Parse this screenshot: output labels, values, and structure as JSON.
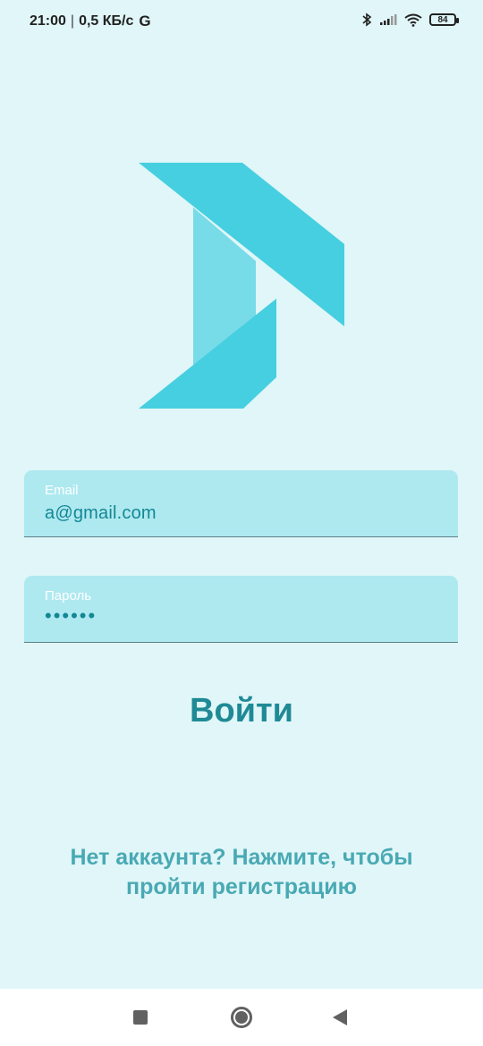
{
  "status_bar": {
    "time": "21:00",
    "separator": "|",
    "network_speed": "0,5 КБ/с",
    "g_icon": "G",
    "battery": "84",
    "icons": [
      "bluetooth-icon",
      "signal-icon",
      "wifi-icon",
      "battery-icon"
    ]
  },
  "colors": {
    "background": "#e0f6f8",
    "logo_primary": "#46cfe0",
    "logo_secondary": "#78dbe8",
    "field_background": "#aee9f0",
    "accent_text": "#1f8a96",
    "link_text": "#49a9b4"
  },
  "login_form": {
    "email": {
      "label": "Email",
      "value": "a@gmail.com"
    },
    "password": {
      "label": "Пароль",
      "value": "••••••"
    },
    "submit_label": "Войти"
  },
  "register_link": {
    "line1": "Нет аккаунта? Нажмите, чтобы",
    "line2": "пройти регистрацию"
  },
  "nav_bar": {
    "icons": [
      "recents-icon",
      "home-icon",
      "back-icon"
    ]
  }
}
